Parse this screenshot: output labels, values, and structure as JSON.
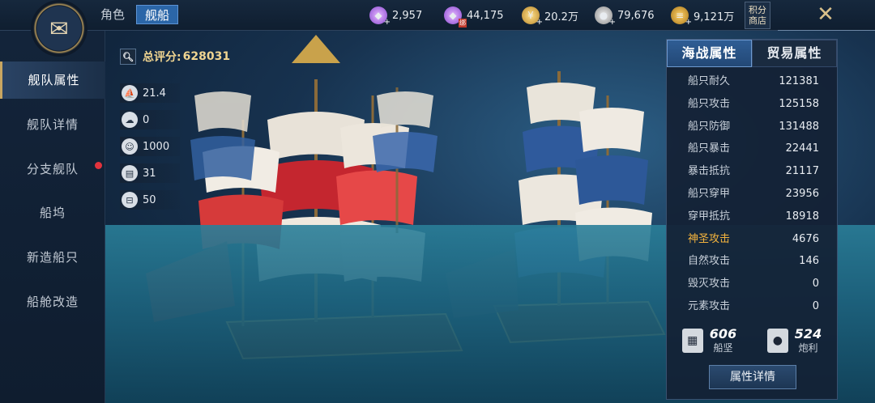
{
  "header": {
    "tabs": [
      {
        "label": "角色",
        "active": false
      },
      {
        "label": "舰船",
        "active": true
      }
    ],
    "resources": [
      {
        "icon": "purple-gem-icon",
        "value": "2,957",
        "has_plus": true,
        "bound": false
      },
      {
        "icon": "purple-gem-bound-icon",
        "value": "44,175",
        "has_plus": false,
        "bound": true,
        "bound_label": "绑"
      },
      {
        "icon": "gold-coin-icon",
        "value": "20.2万",
        "has_plus": true,
        "bound": false
      },
      {
        "icon": "silver-coin-icon",
        "value": "79,676",
        "has_plus": true,
        "bound": false
      },
      {
        "icon": "coin-stack-icon",
        "value": "9,121万",
        "has_plus": true,
        "bound": false
      }
    ],
    "shop_label_line1": "积分",
    "shop_label_line2": "商店",
    "close_icon": "close-x-icon"
  },
  "sidebar": {
    "items": [
      {
        "label": "舰队属性",
        "active": true,
        "badge": false
      },
      {
        "label": "舰队详情",
        "active": false,
        "badge": false
      },
      {
        "label": "分支舰队",
        "active": false,
        "badge": true
      },
      {
        "label": "船坞",
        "active": false,
        "badge": false
      },
      {
        "label": "新造船只",
        "active": false,
        "badge": false
      },
      {
        "label": "船舱改造",
        "active": false,
        "badge": false
      }
    ]
  },
  "score": {
    "label": "总评分:",
    "value": "628031"
  },
  "fleet_stats": [
    {
      "icon": "ship-speed-icon",
      "value": "21.4"
    },
    {
      "icon": "cargo-icon",
      "value": "0"
    },
    {
      "icon": "crew-icon",
      "value": "1000"
    },
    {
      "icon": "supplies-icon",
      "value": "31"
    },
    {
      "icon": "ammo-icon",
      "value": "50"
    }
  ],
  "panel": {
    "tabs": [
      {
        "label": "海战属性",
        "active": true
      },
      {
        "label": "贸易属性",
        "active": false
      }
    ],
    "rows": [
      {
        "key": "船只耐久",
        "value": "121381",
        "highlight": false
      },
      {
        "key": "船只攻击",
        "value": "125158",
        "highlight": false
      },
      {
        "key": "船只防御",
        "value": "131488",
        "highlight": false
      },
      {
        "key": "船只暴击",
        "value": "22441",
        "highlight": false
      },
      {
        "key": "暴击抵抗",
        "value": "21117",
        "highlight": false
      },
      {
        "key": "船只穿甲",
        "value": "23956",
        "highlight": false
      },
      {
        "key": "穿甲抵抗",
        "value": "18918",
        "highlight": false
      },
      {
        "key": "神圣攻击",
        "value": "4676",
        "highlight": true
      },
      {
        "key": "自然攻击",
        "value": "146",
        "highlight": false
      },
      {
        "key": "毁灭攻击",
        "value": "0",
        "highlight": false
      },
      {
        "key": "元素攻击",
        "value": "0",
        "highlight": false
      }
    ],
    "summary": [
      {
        "icon": "armor-icon",
        "value": "606",
        "label": "船坚"
      },
      {
        "icon": "cannon-icon",
        "value": "524",
        "label": "炮利"
      }
    ],
    "detail_button": "属性详情"
  },
  "colors": {
    "accent_blue": "#2b66a8",
    "highlight_orange": "#f4b33d",
    "score_gold": "#f0d591",
    "badge_red": "#e2333d"
  }
}
